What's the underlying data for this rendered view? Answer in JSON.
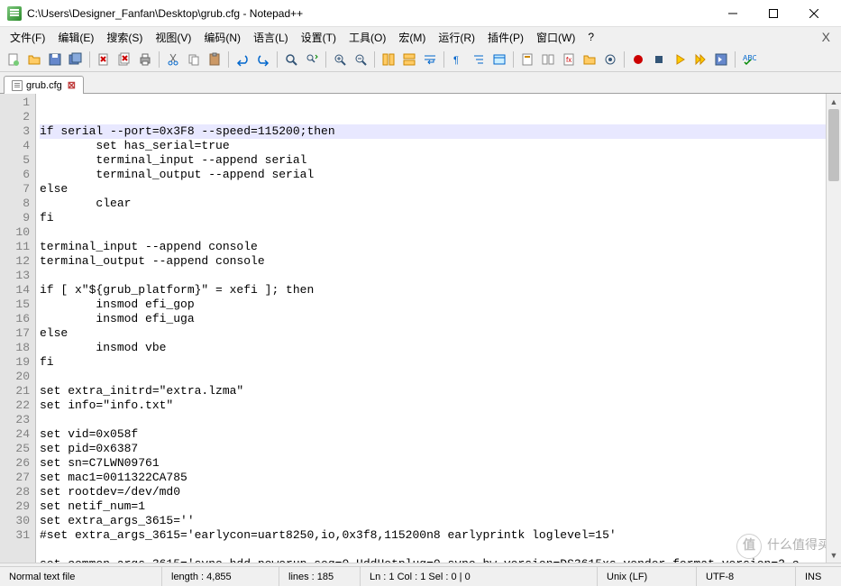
{
  "window": {
    "title": "C:\\Users\\Designer_Fanfan\\Desktop\\grub.cfg - Notepad++"
  },
  "menu": {
    "items": [
      "文件(F)",
      "编辑(E)",
      "搜索(S)",
      "视图(V)",
      "编码(N)",
      "语言(L)",
      "设置(T)",
      "工具(O)",
      "宏(M)",
      "运行(R)",
      "插件(P)",
      "窗口(W)",
      "?"
    ]
  },
  "tab": {
    "label": "grub.cfg"
  },
  "code": {
    "lines": [
      "if serial --port=0x3F8 --speed=115200;then",
      "        set has_serial=true",
      "        terminal_input --append serial",
      "        terminal_output --append serial",
      "else",
      "        clear",
      "fi",
      "",
      "terminal_input --append console",
      "terminal_output --append console",
      "",
      "if [ x\"${grub_platform}\" = xefi ]; then",
      "        insmod efi_gop",
      "        insmod efi_uga",
      "else",
      "        insmod vbe",
      "fi",
      "",
      "set extra_initrd=\"extra.lzma\"",
      "set info=\"info.txt\"",
      "",
      "set vid=0x058f",
      "set pid=0x6387",
      "set sn=C7LWN09761",
      "set mac1=0011322CA785",
      "set rootdev=/dev/md0",
      "set netif_num=1",
      "set extra_args_3615=''",
      "#set extra_args_3615='earlycon=uart8250,io,0x3f8,115200n8 earlyprintk loglevel=15'",
      "",
      "set common_args_3615='syno_hdd_powerup_seq=0 HddHotplug=0 syno_hw_version=DS3615xs vender_format_version=2 c"
    ],
    "highlight_line": 1
  },
  "status": {
    "filetype": "Normal text file",
    "length": "length : 4,855",
    "lines": "lines : 185",
    "pos": "Ln : 1    Col : 1    Sel : 0 | 0",
    "eol": "Unix (LF)",
    "encoding": "UTF-8",
    "mode": "INS"
  },
  "watermark": {
    "badge": "值",
    "text": "什么值得买"
  }
}
